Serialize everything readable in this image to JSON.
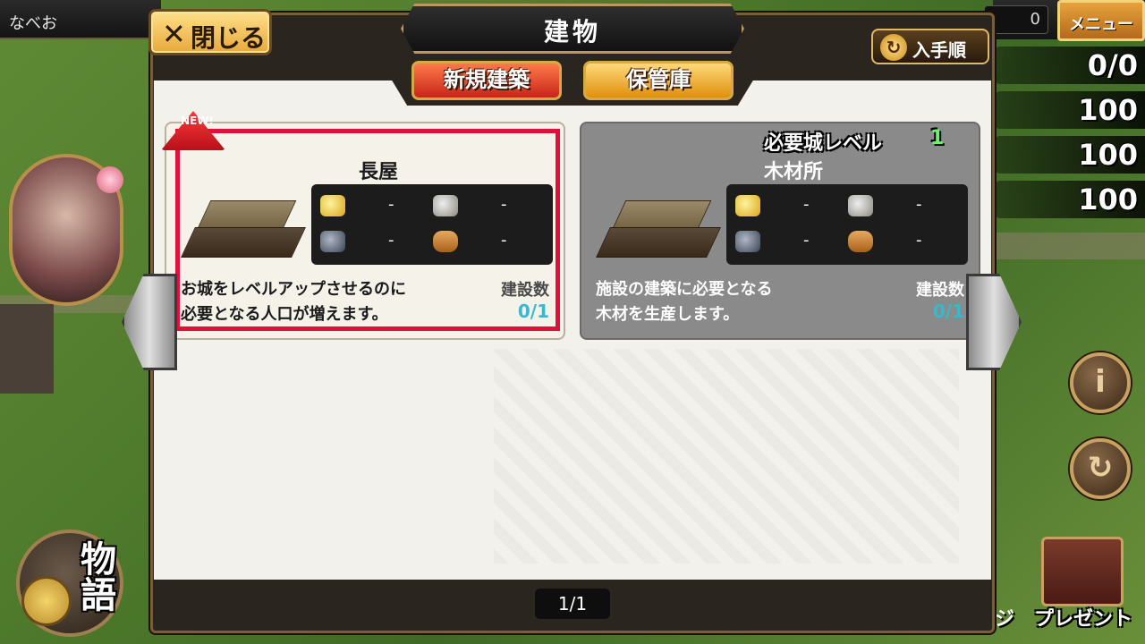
{
  "hud": {
    "player_name": "なべお",
    "count": "0",
    "menu_label": "メニュー",
    "resources": [
      "0/0",
      "100",
      "100",
      "100"
    ],
    "info_icon": "i",
    "refresh_icon": "↻",
    "story_label": "物語",
    "present_label": "プレゼント",
    "partial_label": "ジ"
  },
  "modal": {
    "title": "建物",
    "close_label": "閉じる",
    "close_icon": "✕",
    "sort_label": "入手順",
    "sort_icon": "↻",
    "tabs": [
      {
        "label": "新規建築",
        "active": true
      },
      {
        "label": "保管庫",
        "active": false
      }
    ],
    "page_indicator": "1/1"
  },
  "cards": [
    {
      "name": "長屋",
      "badge": "NEW!",
      "costs": {
        "gold": "-",
        "stone": "-",
        "iron": "-",
        "wood": "-"
      },
      "desc_line1": "お城をレベルアップさせるのに",
      "desc_line2": "必要となる人口が増えます。",
      "built_label": "建設数",
      "built_value": "0/1"
    },
    {
      "name": "木材所",
      "requirement_label": "必要城レベル",
      "requirement_value": "1",
      "costs": {
        "gold": "-",
        "stone": "-",
        "iron": "-",
        "wood": "-"
      },
      "desc_line1": "施設の建築に必要となる",
      "desc_line2": "木材を生産します。",
      "built_label": "建設数",
      "built_value": "0/1"
    }
  ],
  "colors": {
    "highlight": "#e0103a",
    "active_tab": "#c8241a",
    "inactive_tab": "#e0900a",
    "built_value": "#38b8d0",
    "req_value": "#6ef06e"
  }
}
